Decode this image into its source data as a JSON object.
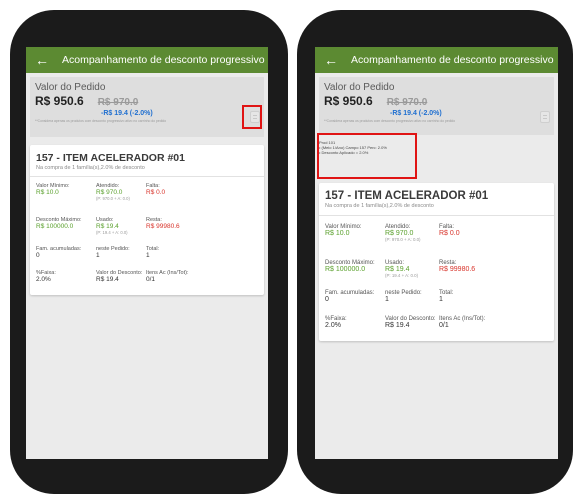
{
  "app": {
    "title": "Acompanhamento de desconto progressivo",
    "back_glyph": "←"
  },
  "summary": {
    "label": "Valor do Pedido",
    "current": "R$ 950.6",
    "original": "R$ 970.0",
    "discount": "-R$ 19.4 (-2.0%)",
    "note": "**Considera apenas os produtos com desconto progressivo ativo no carrinho do pedido",
    "info_icon": "info-list-icon"
  },
  "popup": {
    "lines": [
      "Prod 101",
      "• (Meio 1/Ano) Campo 157 Perc: 2.0%",
      "• Desconto Aplicado = 2.0%"
    ]
  },
  "item": {
    "title": "157 - ITEM ACELERADOR #01",
    "subtitle": "Na compra de 1 família(s),2.0% de desconto",
    "fields": {
      "valor_minimo": {
        "label": "Valor Mínimo:",
        "value": "R$ 10.0"
      },
      "atendido": {
        "label": "Atendido:",
        "value": "R$ 970.0",
        "sub": "(P: 970.0 + A: 0.0)"
      },
      "falta": {
        "label": "Falta:",
        "value": "R$ 0.0"
      },
      "desconto_maximo": {
        "label": "Desconto Máximo:",
        "value": "R$ 100000.0"
      },
      "usado": {
        "label": "Usado:",
        "value": "R$ 19.4",
        "sub": "(P: 19.4 + A: 0.0)"
      },
      "resta": {
        "label": "Resta:",
        "value": "R$ 99980.6"
      },
      "fam_acumuladas": {
        "label": "Fam. acumuladas:",
        "value": "0"
      },
      "neste_pedido": {
        "label": "neste Pedido:",
        "value": "1"
      },
      "total": {
        "label": "Total:",
        "value": "1"
      },
      "faixa": {
        "label": "%Faixa:",
        "value": "2.0%"
      },
      "valor_desconto": {
        "label": "Valor do Desconto:",
        "value": "R$ 19.4"
      },
      "itens_ac": {
        "label": "Itens Ac (Ins/Tot):",
        "value": "0/1"
      }
    }
  },
  "colors": {
    "appbar": "#5c8a32",
    "green_value": "#5aa02c",
    "red_value": "#d8332a",
    "blue_discount": "#1f6fd0",
    "highlight": "#e01414"
  }
}
